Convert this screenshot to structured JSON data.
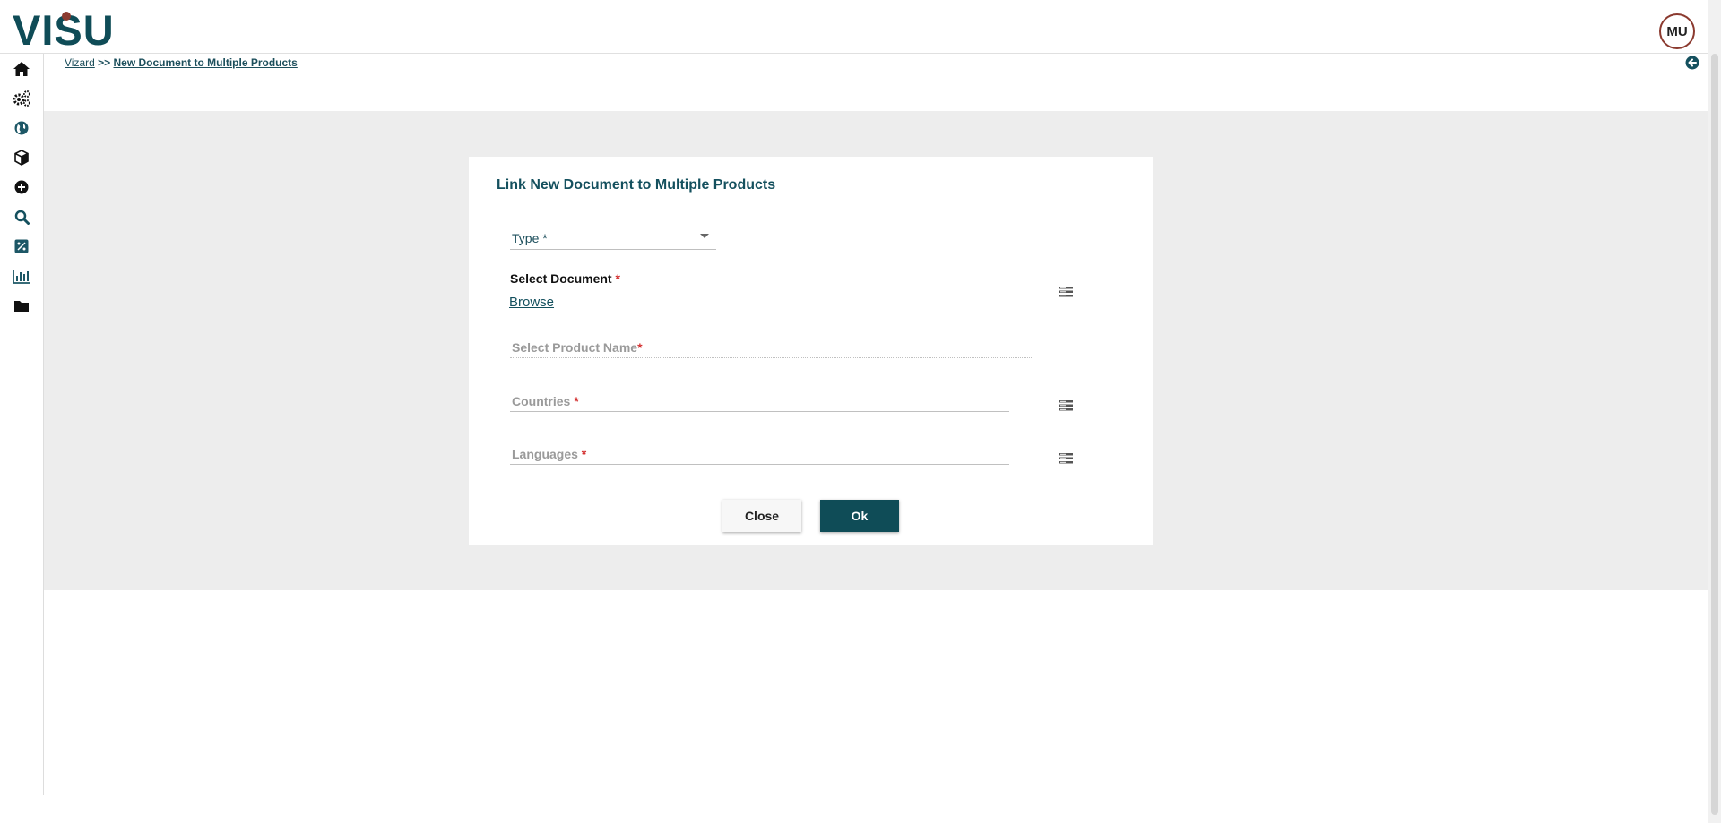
{
  "app": {
    "logo_text": "VISU",
    "user_initials": "MU"
  },
  "breadcrumb": {
    "root": "Vizard",
    "separator": ">>",
    "current": "New Document to Multiple Products"
  },
  "sidebar": [
    {
      "icon": "home-icon"
    },
    {
      "icon": "gears-icon"
    },
    {
      "icon": "globe-icon"
    },
    {
      "icon": "box-icon"
    },
    {
      "icon": "plus-circle-icon"
    },
    {
      "icon": "search-icon"
    },
    {
      "icon": "percent-tag-icon"
    },
    {
      "icon": "bar-chart-icon"
    },
    {
      "icon": "folder-icon"
    }
  ],
  "dialog": {
    "title": "Link New Document to Multiple Products",
    "type_label": "Type *",
    "select_document_label": "Select Document",
    "required_mark": "*",
    "browse_label": "Browse",
    "product_placeholder": "Select Product Name",
    "countries_placeholder": "Countries",
    "languages_placeholder": "Languages",
    "close_label": "Close",
    "ok_label": "Ok"
  },
  "colors": {
    "brand": "#14505e",
    "required": "#d32f2f",
    "logo_accent": "#8b3a2f"
  }
}
